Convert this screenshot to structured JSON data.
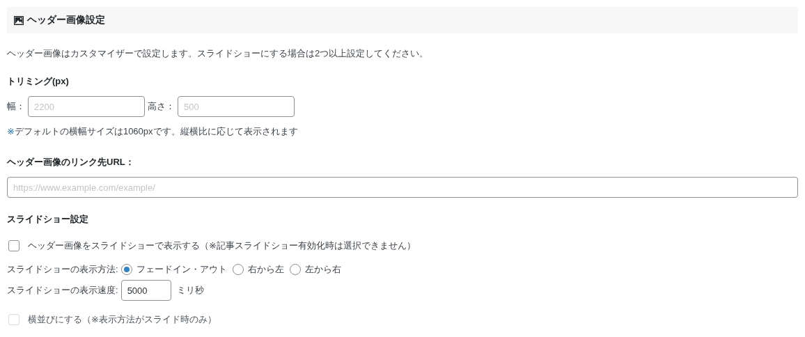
{
  "section": {
    "title": "ヘッダー画像設定"
  },
  "description": "ヘッダー画像はカスタマイザーで設定します。スライドショーにする場合は2つ以上設定してください。",
  "trimming": {
    "label": "トリミング(px)",
    "width_label": "幅：",
    "width_placeholder": "2200",
    "height_label": "高さ：",
    "height_placeholder": "500"
  },
  "note": {
    "mark": "※",
    "text": "デフォルトの横幅サイズは1060pxです。縦横比に応じて表示されます"
  },
  "link": {
    "label": "ヘッダー画像のリンク先URL：",
    "placeholder": "https://www.example.com/example/"
  },
  "slideshow": {
    "label": "スライドショー設定",
    "enable": {
      "label": "ヘッダー画像をスライドショーで表示する（※記事スライドショー有効化時は選択できません）",
      "checked": false,
      "disabled": false
    },
    "method_label": "スライドショーの表示方法:",
    "methods": [
      {
        "label": "フェードイン・アウト",
        "selected": true
      },
      {
        "label": "右から左",
        "selected": false
      },
      {
        "label": "左から右",
        "selected": false
      }
    ],
    "speed_label": "スライドショーの表示速度:",
    "speed_value": "5000",
    "speed_unit": "ミリ秒",
    "side_by_side": {
      "label": "横並びにする（※表示方法がスライド時のみ）",
      "checked": false,
      "disabled": true
    }
  }
}
